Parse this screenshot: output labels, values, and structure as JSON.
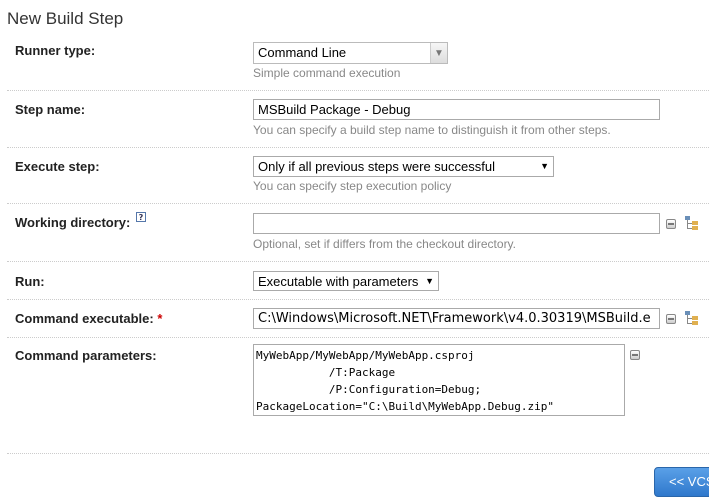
{
  "page": {
    "title": "New Build Step"
  },
  "runner_type": {
    "label": "Runner type:",
    "value": "Command Line",
    "hint": "Simple command execution"
  },
  "step_name": {
    "label": "Step name:",
    "value": "MSBuild Package - Debug",
    "hint": "You can specify a build step name to distinguish it from other steps."
  },
  "execute_step": {
    "label": "Execute step:",
    "value": "Only if all previous steps were successful",
    "hint": "You can specify step execution policy"
  },
  "working_directory": {
    "label": "Working directory:",
    "help": "?",
    "value": "",
    "hint": "Optional, set if differs from the checkout directory."
  },
  "run": {
    "label": "Run:",
    "value": "Executable with parameters"
  },
  "command_executable": {
    "label": "Command executable:",
    "required_mark": "*",
    "value": "C:\\Windows\\Microsoft.NET\\Framework\\v4.0.30319\\MSBuild.e"
  },
  "command_parameters": {
    "label": "Command parameters:",
    "value": "MyWebApp/MyWebApp/MyWebApp.csproj\n           /T:Package\n           /P:Configuration=Debug;\nPackageLocation=\"C:\\Build\\MyWebApp.Debug.zip\""
  },
  "footer": {
    "vcs_button_label": "<< VCS"
  },
  "icons": {
    "arrow": "▼",
    "help": "?"
  }
}
